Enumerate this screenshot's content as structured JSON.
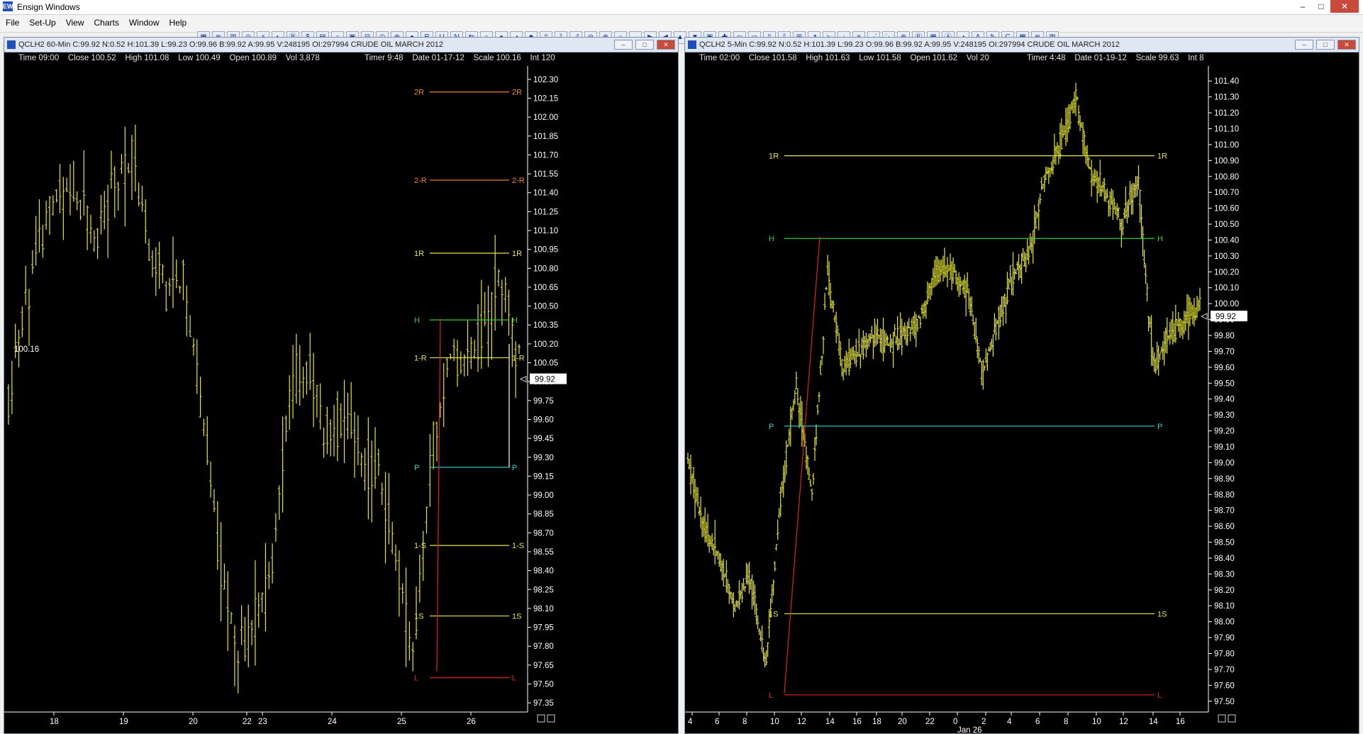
{
  "app": {
    "title": "Ensign Windows",
    "icon": "ensign-app-icon",
    "window_buttons": [
      "–",
      "□",
      "✕"
    ]
  },
  "menu": {
    "items": [
      "File",
      "Set-Up",
      "View",
      "Charts",
      "Window",
      "Help"
    ]
  },
  "toolbar": {
    "button_count": 58
  },
  "left": {
    "title": "QCLH2 60-Min C:99.92 N:0.52 H:101.39 L:99.23 O:99.96 B:99.92 A:99.95 V:248195 OI:297994 CRUDE OIL MARCH 2012",
    "info": "Time 09:00    Close 100.52    High 101.08    Low 100.49    Open 100.89    Vol 3,878",
    "info2": "Timer 9:48    Date 01-17-12    Scale 100.16    Int 120",
    "cursor_label": "100.16",
    "last_price": "99.92",
    "y_ticks": [
      "102.30",
      "102.15",
      "102.00",
      "101.85",
      "101.70",
      "101.55",
      "101.40",
      "101.25",
      "101.10",
      "100.95",
      "100.80",
      "100.65",
      "100.50",
      "100.35",
      "100.20",
      "100.05",
      "99.90",
      "99.75",
      "99.60",
      "99.45",
      "99.30",
      "99.15",
      "99.00",
      "98.85",
      "98.70",
      "98.55",
      "98.40",
      "98.25",
      "98.10",
      "97.95",
      "97.80",
      "97.65",
      "97.50",
      "97.35"
    ],
    "x_ticks": [
      "18",
      "19",
      "20",
      "22",
      "23",
      "24",
      "25",
      "26"
    ],
    "pivots": [
      {
        "label": "2R",
        "value": 102.2,
        "color": "#e8822a"
      },
      {
        "label": "2-R",
        "value": 101.5,
        "color": "#e8822a"
      },
      {
        "label": "1R",
        "value": 100.92,
        "color": "#e7e64a"
      },
      {
        "label": "H",
        "value": 100.39,
        "color": "#33cc33"
      },
      {
        "label": "1-R",
        "value": 100.09,
        "color": "#e7e64a"
      },
      {
        "label": "P",
        "value": 99.22,
        "color": "#33d6d6"
      },
      {
        "label": "1-S",
        "value": 98.6,
        "color": "#e7e64a"
      },
      {
        "label": "1S",
        "value": 98.04,
        "color": "#e7e64a"
      },
      {
        "label": "L",
        "value": 97.55,
        "color": "#e02020"
      }
    ]
  },
  "right": {
    "title": "QCLH2 5-Min C:99.92 N:0.52 H:101.39 L:99.23 O:99.96 B:99.92 A:99.95 V:248195 OI:297994 CRUDE OIL MARCH 2012",
    "info": "Time 02:00    Close 101.58    High 101.63    Low 101.58    Open 101.62    Vol 20",
    "info2": "Timer 4:48    Date 01-19-12    Scale 99.63    Int 8",
    "last_price": "99.92",
    "y_ticks": [
      "101.40",
      "101.30",
      "101.20",
      "101.10",
      "101.00",
      "100.90",
      "100.80",
      "100.70",
      "100.60",
      "100.50",
      "100.40",
      "100.30",
      "100.20",
      "100.10",
      "100.00",
      "99.90",
      "99.80",
      "99.70",
      "99.60",
      "99.50",
      "99.40",
      "99.30",
      "99.20",
      "99.10",
      "99.00",
      "98.90",
      "98.80",
      "98.70",
      "98.60",
      "98.50",
      "98.40",
      "98.30",
      "98.20",
      "98.10",
      "98.00",
      "97.90",
      "97.80",
      "97.70",
      "97.60",
      "97.50"
    ],
    "x_ticks": [
      "4",
      "6",
      "8",
      "10",
      "12",
      "14",
      "16",
      "18",
      "20",
      "22",
      "0",
      "2",
      "4",
      "6",
      "8",
      "10",
      "12",
      "14",
      "16"
    ],
    "x_sublabel": "Jan 26",
    "pivots": [
      {
        "label": "1R",
        "value": 100.93,
        "color": "#e7e64a"
      },
      {
        "label": "H",
        "value": 100.41,
        "color": "#33cc33"
      },
      {
        "label": "P",
        "value": 99.23,
        "color": "#33d6d6"
      },
      {
        "label": "1S",
        "value": 98.05,
        "color": "#e7e64a"
      },
      {
        "label": "L",
        "value": 97.54,
        "color": "#e02020"
      }
    ]
  },
  "chart_data": [
    {
      "type": "bar",
      "title": "QCLH2 60-Min",
      "x_ticks": [
        "18",
        "19",
        "20",
        "22",
        "23",
        "24",
        "25",
        "26"
      ],
      "ylim": [
        97.3,
        102.35
      ],
      "levels": {
        "2R": 102.2,
        "2-R": 101.5,
        "1R": 100.92,
        "H": 100.39,
        "1-R": 100.09,
        "P": 99.22,
        "1-S": 98.6,
        "1S": 98.04,
        "L": 97.55
      },
      "last": 99.92
    },
    {
      "type": "bar",
      "title": "QCLH2 5-Min",
      "x_ticks": [
        "4",
        "6",
        "8",
        "10",
        "12",
        "14",
        "16",
        "18",
        "20",
        "22",
        "0",
        "2",
        "4",
        "6",
        "8",
        "10",
        "12",
        "14",
        "16"
      ],
      "ylim": [
        97.45,
        101.45
      ],
      "levels": {
        "1R": 100.93,
        "H": 100.41,
        "P": 99.23,
        "1S": 98.05,
        "L": 97.54
      },
      "last": 99.92
    }
  ],
  "colors": {
    "bars": "#e6e633",
    "axis_text": "#ffffff",
    "background": "#000000"
  }
}
